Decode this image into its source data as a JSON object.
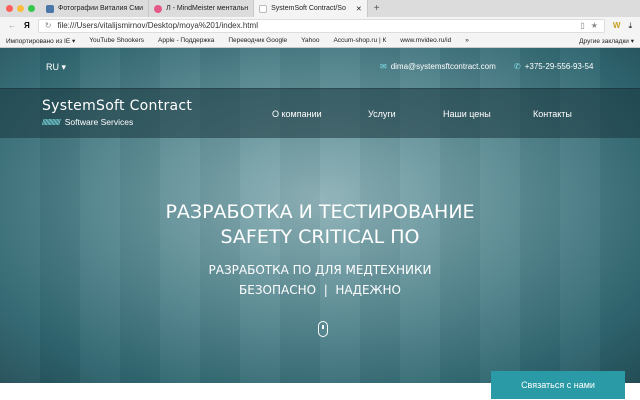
{
  "browser": {
    "tabs": [
      {
        "label": "Фотографии Виталия Сми",
        "color": "#4a76a8"
      },
      {
        "label": "Л - MindMeister ментальн",
        "color": "#e5588a"
      },
      {
        "label": "SystemSoft Contract/So",
        "color": "#ffffff"
      }
    ],
    "address": "file:///Users/vitalijsmirnov/Desktop/moya%201/index.html",
    "yandex": "Я",
    "bookmarks": [
      "Импортировано из IE ▾",
      "YouTube Shookers",
      "Apple - Поддержка",
      "Переводчик Google",
      "Yahoo",
      "Accum-shop.ru | К",
      "www.mvideo.ru/id",
      "»"
    ],
    "other_bookmarks": "Другие закладки ▾"
  },
  "site": {
    "lang": "RU",
    "email": "dima@systemsftcontract.com",
    "phone": "+375-29-556-93-54",
    "logo_title": "SystemSoft Contract",
    "logo_slashes": "/////////////",
    "logo_sub": "Software Services",
    "nav": [
      "О компании",
      "Услуги",
      "Наши цены",
      "Контакты"
    ],
    "headline1": "РАЗРАБОТКА И ТЕСТИРОВАНИЕ",
    "headline2": "SAFETY CRITICAL ПО",
    "sub1": "РАЗРАБОТКА ПО ДЛЯ МЕДТЕХНИКИ",
    "sub2": "БЕЗОПАСНО  |  НАДЕЖНО",
    "cta": "Связаться с нами"
  }
}
